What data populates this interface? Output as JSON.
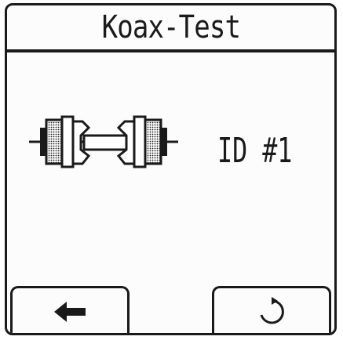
{
  "header": {
    "title": "Koax-Test"
  },
  "main": {
    "cable_icon": "coax-cable-icon",
    "id_label": "ID #1"
  },
  "footer": {
    "back_icon": "arrow-left-icon",
    "refresh_icon": "refresh-icon"
  },
  "colors": {
    "foreground": "#1a1a1a",
    "background": "#fcfcfc"
  }
}
